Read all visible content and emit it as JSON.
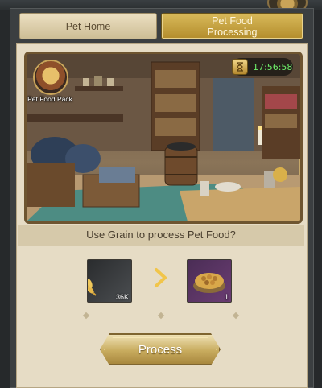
{
  "tabs": [
    {
      "label": "Pet Home",
      "active": false
    },
    {
      "label": "Pet Food Processing",
      "active": true
    }
  ],
  "scene": {
    "pack_label": "Pet Food Pack",
    "pack_icon": "treasure-chest-icon",
    "timer_icon": "hourglass-icon",
    "timer": "17:56:58"
  },
  "prompt": "Use Grain to process Pet Food?",
  "recipe": {
    "input": {
      "icon": "grain-icon",
      "count": "36K"
    },
    "arrow_icon": "chevron-right-icon",
    "output": {
      "icon": "pet-food-bowl-icon",
      "count": "1"
    }
  },
  "process_button": {
    "label": "Process"
  },
  "colors": {
    "accent_gold": "#c8ab5e",
    "panel_bg": "#e6dcc5",
    "timer_green": "#6ef06a",
    "frame_dark": "#3b3f41"
  }
}
